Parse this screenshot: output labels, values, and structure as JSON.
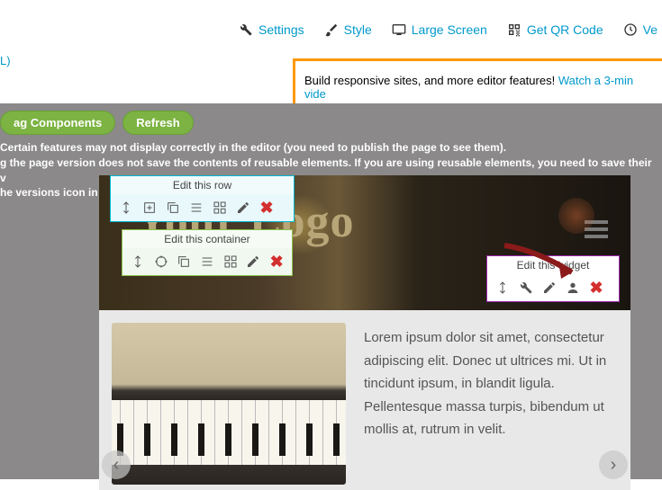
{
  "nav": {
    "settings": "Settings",
    "style": "Style",
    "large_screen": "Large Screen",
    "qr": "Get QR Code",
    "ve": "Ve"
  },
  "url_tail": "L)",
  "promo": {
    "text": "Build responsive sites, and more editor features! ",
    "link": "Watch a 3-min vide"
  },
  "buttons": {
    "drag": "ag Components",
    "refresh": "Refresh"
  },
  "warnings": {
    "l1": "Certain features may not display correctly in the editor (you need to publish the page to see them).",
    "l2": "g the page version does not save the contents of reusable elements. If you are using reusable elements, you need to save their v",
    "l3": "he versions icon in reusable elements.)"
  },
  "panels": {
    "row": "Edit this row",
    "container": "Edit this container",
    "widget": "Edit this widget"
  },
  "logo": "Your Logo",
  "para": "Lorem ipsum dolor sit amet, consectetur adipiscing elit. Donec ut ultrices mi. Ut in tincidunt ipsum, in blandit ligula. Pellentesque massa turpis, bibendum ut mollis at, rutrum in velit."
}
